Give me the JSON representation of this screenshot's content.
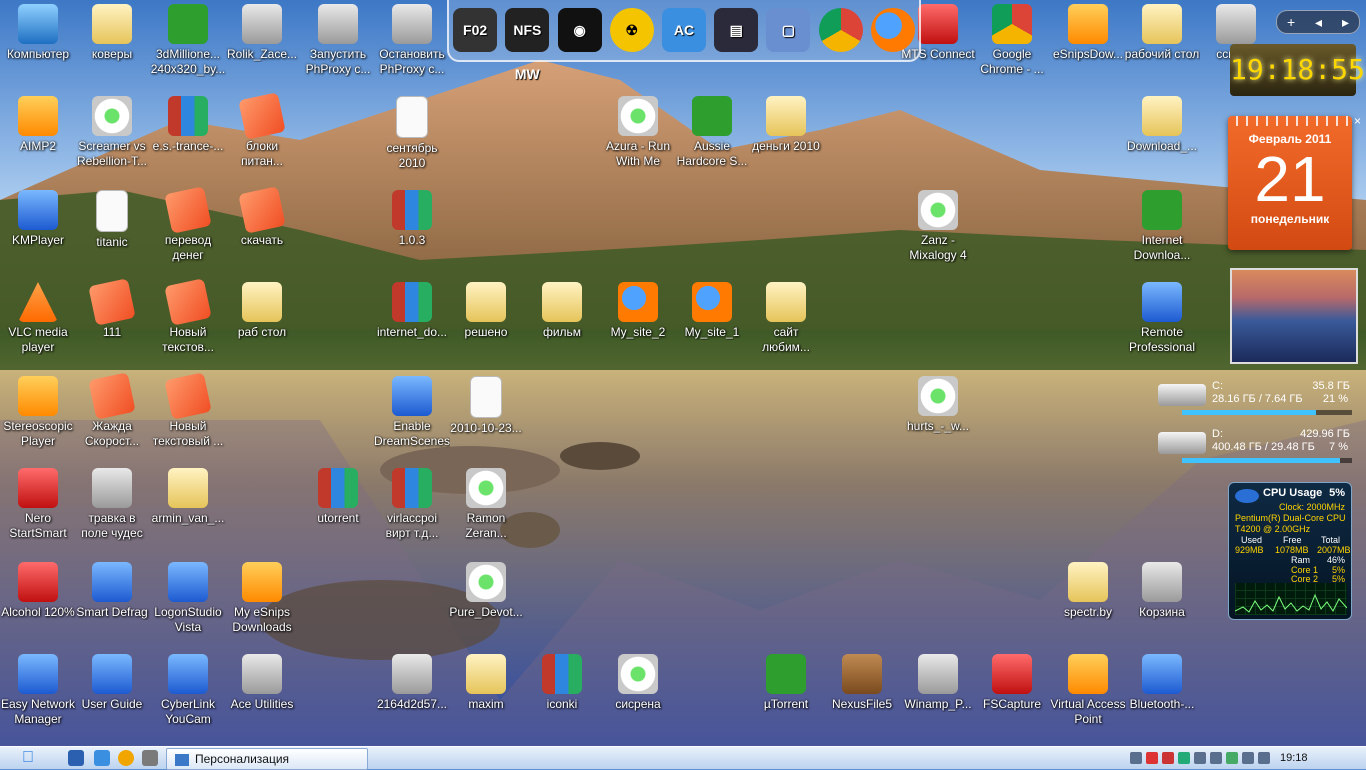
{
  "desktop_icons": [
    {
      "label": "Компьютер",
      "icon": "computer-icon",
      "style": "i-pc",
      "col": 0,
      "row": 0
    },
    {
      "label": "коверы",
      "icon": "folder-icon",
      "style": "i-folder",
      "col": 1,
      "row": 0
    },
    {
      "label": "3dMillione... 240x320_by...",
      "icon": "app-icon",
      "style": "i-green",
      "col": 2,
      "row": 0
    },
    {
      "label": "Rolik_Zace...",
      "icon": "flv-icon",
      "style": "i-gray",
      "col": 3,
      "row": 0
    },
    {
      "label": "Запустить PhProxy с...",
      "icon": "settings-icon",
      "style": "i-gray",
      "col": 4,
      "row": 0
    },
    {
      "label": "Остановить PhProxy с...",
      "icon": "settings-icon",
      "style": "i-gray",
      "col": 5,
      "row": 0
    },
    {
      "label": "MTS Connect",
      "icon": "mts-icon",
      "style": "i-red",
      "col": 12,
      "row": 0
    },
    {
      "label": "Google Chrome - ...",
      "icon": "chrome-icon",
      "style": "i-chrome",
      "col": 13,
      "row": 0
    },
    {
      "label": "eSnipsDow...",
      "icon": "esnips-icon",
      "style": "i-orange",
      "col": 14,
      "row": 0
    },
    {
      "label": "рабочий стол",
      "icon": "folder-icon",
      "style": "i-folder",
      "col": 15,
      "row": 0
    },
    {
      "label": "ссылки",
      "icon": "shortcut-icon",
      "style": "i-gray",
      "col": 16,
      "row": 0
    },
    {
      "label": "AIMP2",
      "icon": "aimp-icon",
      "style": "i-orange",
      "col": 0,
      "row": 1
    },
    {
      "label": "Screamer vs Rebellion-T...",
      "icon": "audio-icon",
      "style": "i-audio",
      "col": 1,
      "row": 1
    },
    {
      "label": "e.s.-trance-...",
      "icon": "winrar-icon",
      "style": "i-rar",
      "col": 2,
      "row": 1
    },
    {
      "label": "блоки питан...",
      "icon": "note-icon",
      "style": "i-note",
      "col": 3,
      "row": 1
    },
    {
      "label": "сентябрь 2010",
      "icon": "text-file-icon",
      "style": "i-txt",
      "col": 5,
      "row": 1
    },
    {
      "label": "Azura - Run With Me",
      "icon": "audio-icon",
      "style": "i-audio",
      "col": 8,
      "row": 1
    },
    {
      "label": "Aussie Hardcore S...",
      "icon": "utorrent-icon",
      "style": "i-green",
      "col": 9,
      "row": 1
    },
    {
      "label": "деньги 2010",
      "icon": "folder-icon",
      "style": "i-folder",
      "col": 10,
      "row": 1
    },
    {
      "label": "Download_...",
      "icon": "folder-icon",
      "style": "i-folder",
      "col": 15,
      "row": 1
    },
    {
      "label": "KMPlayer",
      "icon": "kmplayer-icon",
      "style": "i-blue",
      "col": 0,
      "row": 2
    },
    {
      "label": "titanic",
      "icon": "text-file-icon",
      "style": "i-txt",
      "col": 1,
      "row": 2
    },
    {
      "label": "перевод денег",
      "icon": "note-icon",
      "style": "i-note",
      "col": 2,
      "row": 2
    },
    {
      "label": "скачать",
      "icon": "note-icon",
      "style": "i-note",
      "col": 3,
      "row": 2
    },
    {
      "label": "1.0.3",
      "icon": "winrar-icon",
      "style": "i-rar",
      "col": 5,
      "row": 2
    },
    {
      "label": "Zanz - Mixalogy 4",
      "icon": "audio-icon",
      "style": "i-audio",
      "col": 12,
      "row": 2
    },
    {
      "label": "Internet Downloa...",
      "icon": "download-manager-icon",
      "style": "i-green",
      "col": 15,
      "row": 2
    },
    {
      "label": "VLC media player",
      "icon": "vlc-icon",
      "style": "i-vlc",
      "col": 0,
      "row": 3
    },
    {
      "label": "111",
      "icon": "note-icon",
      "style": "i-note",
      "col": 1,
      "row": 3
    },
    {
      "label": "Новый текстов...",
      "icon": "note-icon",
      "style": "i-note",
      "col": 2,
      "row": 3
    },
    {
      "label": "раб стол",
      "icon": "folder-icon",
      "style": "i-folder",
      "col": 3,
      "row": 3
    },
    {
      "label": "internet_do...",
      "icon": "winrar-icon",
      "style": "i-rar",
      "col": 5,
      "row": 3
    },
    {
      "label": "решено",
      "icon": "folder-icon",
      "style": "i-folder",
      "col": 6,
      "row": 3
    },
    {
      "label": "фильм",
      "icon": "folder-icon",
      "style": "i-folder",
      "col": 7,
      "row": 3
    },
    {
      "label": "My_site_2",
      "icon": "firefox-doc-icon",
      "style": "i-ff",
      "col": 8,
      "row": 3
    },
    {
      "label": "My_site_1",
      "icon": "firefox-doc-icon",
      "style": "i-ff",
      "col": 9,
      "row": 3
    },
    {
      "label": "сайт любим...",
      "icon": "folder-icon",
      "style": "i-folder",
      "col": 10,
      "row": 3
    },
    {
      "label": "Remote Professional",
      "icon": "remote-icon",
      "style": "i-blue",
      "col": 15,
      "row": 3
    },
    {
      "label": "Stereoscopic Player",
      "icon": "stereo-player-icon",
      "style": "i-orange",
      "col": 0,
      "row": 4
    },
    {
      "label": "Жажда Скорост...",
      "icon": "note-icon",
      "style": "i-note",
      "col": 1,
      "row": 4
    },
    {
      "label": "Новый текстовый ...",
      "icon": "note-icon",
      "style": "i-note",
      "col": 2,
      "row": 4
    },
    {
      "label": "Enable DreamScenes",
      "icon": "window-app-icon",
      "style": "i-blue",
      "col": 5,
      "row": 4
    },
    {
      "label": "2010-10-23...",
      "icon": "document-icon",
      "style": "i-txt",
      "col": 6,
      "row": 4
    },
    {
      "label": "hurts_-_w...",
      "icon": "audio-icon",
      "style": "i-audio",
      "col": 12,
      "row": 4
    },
    {
      "label": "Nero StartSmart",
      "icon": "nero-icon",
      "style": "i-red",
      "col": 0,
      "row": 5
    },
    {
      "label": "травка в поле чудес",
      "icon": "flv-icon",
      "style": "i-gray",
      "col": 1,
      "row": 5
    },
    {
      "label": "armin_van_...",
      "icon": "folder-icon",
      "style": "i-folder",
      "col": 2,
      "row": 5
    },
    {
      "label": "utorrent",
      "icon": "winrar-icon",
      "style": "i-rar",
      "col": 4,
      "row": 5
    },
    {
      "label": "virlaccpoi вирт т.д...",
      "icon": "winrar-icon",
      "style": "i-rar",
      "col": 5,
      "row": 5
    },
    {
      "label": "Ramon Zeran...",
      "icon": "audio-icon",
      "style": "i-audio",
      "col": 6,
      "row": 5
    },
    {
      "label": "Alcohol 120%",
      "icon": "alcohol-icon",
      "style": "i-red",
      "col": 0,
      "row": 6
    },
    {
      "label": "Smart Defrag",
      "icon": "defrag-icon",
      "style": "i-blue",
      "col": 1,
      "row": 6
    },
    {
      "label": "LogonStudio Vista",
      "icon": "logonstudio-icon",
      "style": "i-blue",
      "col": 2,
      "row": 6
    },
    {
      "label": "My eSnips Downloads",
      "icon": "esnips-icon",
      "style": "i-orange",
      "col": 3,
      "row": 6
    },
    {
      "label": "Pure_Devot...",
      "icon": "audio-icon",
      "style": "i-audio",
      "col": 6,
      "row": 6
    },
    {
      "label": "spectr.by",
      "icon": "folder-icon",
      "style": "i-folder",
      "col": 14,
      "row": 6
    },
    {
      "label": "Корзина",
      "icon": "recycle-bin-icon",
      "style": "i-gray",
      "col": 15,
      "row": 6
    },
    {
      "label": "Easy Network Manager",
      "icon": "network-manager-icon",
      "style": "i-blue",
      "col": 0,
      "row": 7
    },
    {
      "label": "User Guide",
      "icon": "user-guide-icon",
      "style": "i-blue",
      "col": 1,
      "row": 7
    },
    {
      "label": "CyberLink YouCam",
      "icon": "youcam-icon",
      "style": "i-blue",
      "col": 2,
      "row": 7
    },
    {
      "label": "Ace Utilities",
      "icon": "ace-utilities-icon",
      "style": "i-gray",
      "col": 3,
      "row": 7
    },
    {
      "label": "2164d2d57...",
      "icon": "image-file-icon",
      "style": "i-gray",
      "col": 5,
      "row": 7
    },
    {
      "label": "maxim",
      "icon": "folder-icon",
      "style": "i-folder",
      "col": 6,
      "row": 7
    },
    {
      "label": "iconki",
      "icon": "winrar-icon",
      "style": "i-rar",
      "col": 7,
      "row": 7
    },
    {
      "label": "сисрена",
      "icon": "audio-icon",
      "style": "i-audio",
      "col": 8,
      "row": 7
    },
    {
      "label": "µTorrent",
      "icon": "utorrent-icon",
      "style": "i-green",
      "col": 10,
      "row": 7
    },
    {
      "label": "NexusFile5",
      "icon": "nexusfile-icon",
      "style": "i-wood",
      "col": 11,
      "row": 7
    },
    {
      "label": "Winamp_P...",
      "icon": "headphones-icon",
      "style": "i-gray",
      "col": 12,
      "row": 7
    },
    {
      "label": "FSCapture",
      "icon": "fscapture-icon",
      "style": "i-red",
      "col": 13,
      "row": 7
    },
    {
      "label": "Virtual Access Point",
      "icon": "access-point-icon",
      "style": "i-orange",
      "col": 14,
      "row": 7
    },
    {
      "label": "Bluetooth-...",
      "icon": "bluetooth-icon",
      "style": "i-blue",
      "col": 15,
      "row": 7
    }
  ],
  "dock_items": [
    {
      "label": "F02",
      "icon": "f02-game-icon"
    },
    {
      "label": "NFS MW",
      "icon": "nfs-mw-icon"
    },
    {
      "label": "◉",
      "icon": "eye-icon"
    },
    {
      "label": "☢",
      "icon": "radiation-icon"
    },
    {
      "label": "AC",
      "icon": "ac-settings-icon"
    },
    {
      "label": "▤",
      "icon": "media-box-icon"
    },
    {
      "label": "▢",
      "icon": "window-switch-icon"
    },
    {
      "label": "",
      "icon": "chrome-icon"
    },
    {
      "label": "",
      "icon": "firefox-icon"
    }
  ],
  "gadgets": {
    "top_controls": {
      "add": "+",
      "prev": "◂",
      "next": "▸"
    },
    "clock": {
      "time": "19:18:55"
    },
    "calendar": {
      "month": "Февраль 2011",
      "day": "21",
      "weekday": "понедельник",
      "close": "×"
    },
    "drives": [
      {
        "letter": "C:",
        "size": "35.8 ГБ",
        "usage": "28.16 ГБ / 7.64 ГБ",
        "percent": "21 %",
        "fill": 0.79
      },
      {
        "letter": "D:",
        "size": "429.96 ГБ",
        "usage": "400.48 ГБ / 29.48 ГБ",
        "percent": "7 %",
        "fill": 0.93
      }
    ],
    "cpu": {
      "title": "CPU Usage",
      "value": "5%",
      "clock": "Clock: 2000MHz",
      "model": "Pentium(R) Dual-Core CPU",
      "model2": "T4200 @ 2.00GHz",
      "used_h": "Used",
      "free_h": "Free",
      "total_h": "Total",
      "used": "929MB",
      "free": "1078MB",
      "total": "2007MB",
      "ram_l": "Ram",
      "ram": "46%",
      "core1_l": "Core 1",
      "core1": "5%",
      "core2_l": "Core 2",
      "core2": "5%"
    }
  },
  "taskbar": {
    "task_label": "Персонализация",
    "time": "19:18"
  }
}
